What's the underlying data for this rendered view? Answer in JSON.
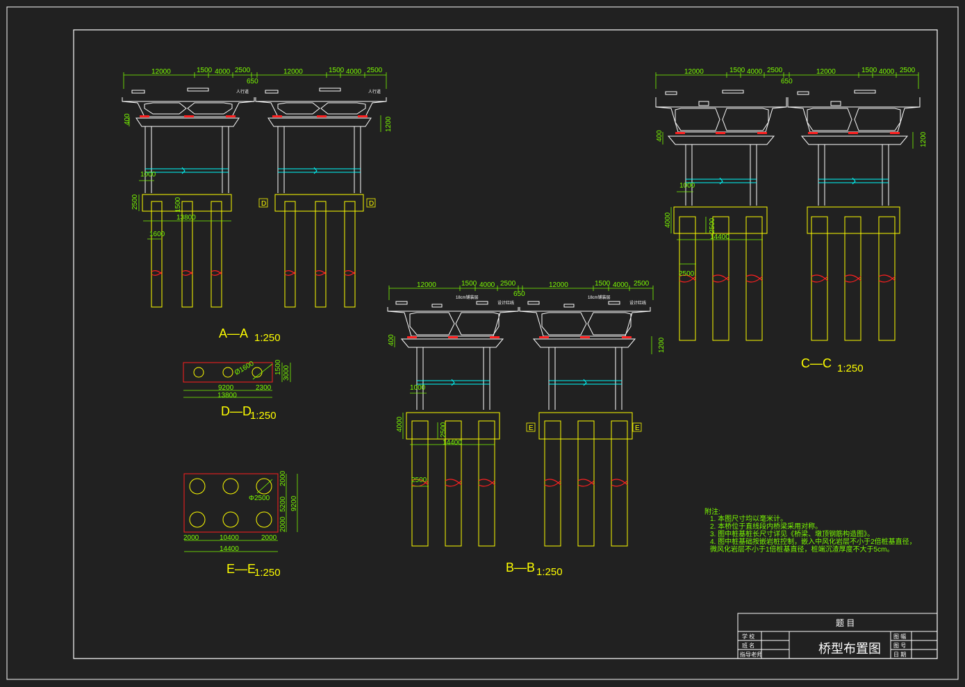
{
  "colors": {
    "background": "#212121",
    "frame": "#FFFFFF",
    "dimension": "#7CFC00",
    "pile": "#FFFF00",
    "bearing": "#FF2020",
    "tie_beam": "#00FFFF"
  },
  "sections": {
    "aa": {
      "title": "A—A",
      "scale": "1:250",
      "dims_top": [
        "12000",
        "1500",
        "4000",
        "2500",
        "12000",
        "1500",
        "4000",
        "2500"
      ],
      "dim_650": "650",
      "dim_400": "400",
      "dim_1200": "1200",
      "dim_1000": "1000",
      "dim_2500": "2500",
      "dim_1500": "1500",
      "dim_13800": "13800",
      "dim_1600": "1600",
      "marks": [
        "D",
        "D"
      ],
      "deck_note": "人行道"
    },
    "bb": {
      "title": "B—B",
      "scale": "1:250",
      "dims_top": [
        "12000",
        "1500",
        "4000",
        "2500",
        "12000",
        "1500",
        "4000",
        "2500"
      ],
      "dim_650": "650",
      "dim_400": "400",
      "dim_1200": "1200",
      "dim_1000": "1000",
      "dim_4000": "4000",
      "dim_2500": "2500",
      "dim_14400": "14400",
      "dim_2500b": "2500",
      "marks": [
        "E",
        "E"
      ],
      "deck_note": "18cm铺装层",
      "deck_note2": "设计红线"
    },
    "cc": {
      "title": "C—C",
      "scale": "1:250",
      "dims_top": [
        "12000",
        "1500",
        "4000",
        "2500",
        "12000",
        "1500",
        "4000",
        "2500"
      ],
      "dim_650": "650",
      "dim_400": "400",
      "dim_1200": "1200",
      "dim_1000": "1000",
      "dim_4000": "4000",
      "dim_2500": "2500",
      "dim_14400": "14400",
      "dim_2500b": "2500"
    },
    "dd": {
      "title": "D—D",
      "scale": "1:250",
      "dia": "Ø1600",
      "dim_1500": "1500",
      "dim_3000": "3000",
      "dim_9200": "9200",
      "dim_2300": "2300",
      "dim_13800": "13800"
    },
    "ee": {
      "title": "E—E",
      "scale": "1:250",
      "dia": "Φ2500",
      "dim_2000a": "2000",
      "dim_5200": "5200",
      "dim_2000b": "2000",
      "dim_9200": "9200",
      "dim_2000c": "2000",
      "dim_10400": "10400",
      "dim_2000d": "2000",
      "dim_14400": "14400"
    }
  },
  "notes": {
    "heading": "附注:",
    "lines": [
      "1. 本图尺寸均以毫米计。",
      "2. 本桥位于直线段内桥梁采用对称。",
      "3. 图中桩基桩长尺寸详见《桥梁、墩顶钢筋构造图》。",
      "4. 图中桩基础按嵌岩桩控制，嵌入中风化岩层不小于2倍桩基直径，",
      "   微风化岩层不小于1倍桩基直径，桩端沉渣厚度不大于5cm。"
    ]
  },
  "title_block": {
    "subject_label": "题 目",
    "drawing_title": "桥型布置图",
    "left_labels": [
      "学 校",
      "班 名",
      "指导老师"
    ],
    "right_labels": [
      "图 幅",
      "图 号",
      "日 期"
    ]
  }
}
